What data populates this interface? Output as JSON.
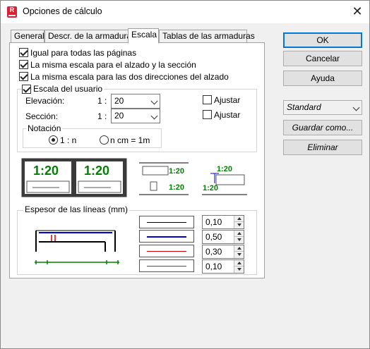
{
  "window": {
    "title": "Opciones de cálculo",
    "icon_letter": "R"
  },
  "tabs": [
    {
      "label": "General"
    },
    {
      "label": "Descr. de la armadura"
    },
    {
      "label": "Escala"
    },
    {
      "label": "Tablas de las armaduras"
    }
  ],
  "checks": {
    "same_all_pages": {
      "label": "Igual para todas las páginas",
      "checked": true
    },
    "same_elevation_section": {
      "label": "La misma escala para el alzado y la sección",
      "checked": true
    },
    "same_both_directions": {
      "label": "La misma escala para las dos direcciones del alzado",
      "checked": true
    }
  },
  "user_scale": {
    "title": "Escala del usuario",
    "checked": true,
    "elevation": {
      "label": "Elevación:",
      "prefix": "1 :",
      "value": "20",
      "adjust_label": "Ajustar",
      "adjust_checked": false
    },
    "section": {
      "label": "Sección:",
      "prefix": "1 :",
      "value": "20",
      "adjust_label": "Ajustar",
      "adjust_checked": false
    },
    "notation": {
      "title": "Notación",
      "options": [
        "1 : n",
        "n cm = 1m"
      ],
      "selected": "1 : n"
    }
  },
  "preview": {
    "big_a": "1:20",
    "big_b": "1:20",
    "mid_top": "1:20",
    "mid_bottom": "1:20",
    "right_top": "1:20",
    "right_bottom": "1:20",
    "green": "#008000"
  },
  "line_thickness": {
    "title": "Espesor de las líneas (mm)",
    "rows": [
      {
        "value": "0,10",
        "color": "#000000"
      },
      {
        "value": "0,50",
        "color": "#0000cc"
      },
      {
        "value": "0,30",
        "color": "#cc0000"
      },
      {
        "value": "0,10",
        "color": "#008000"
      }
    ]
  },
  "buttons": {
    "ok": "OK",
    "cancel": "Cancelar",
    "help": "Ayuda",
    "preset_value": "Standard",
    "save_as": "Guardar como...",
    "delete": "Eliminar"
  }
}
